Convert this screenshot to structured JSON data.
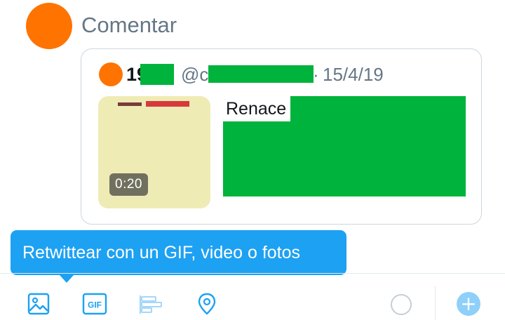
{
  "compose": {
    "placeholder": "Comentar"
  },
  "quoted_tweet": {
    "name_visible": "19",
    "handle_visible": "@c",
    "separator": "·",
    "date": "15/4/19",
    "text_visible": "Renace",
    "media": {
      "duration": "0:20"
    }
  },
  "tooltip": {
    "text": "Retwittear con un GIF, video o fotos"
  },
  "toolbar": {
    "gif_label": "GIF",
    "add_symbol": "+"
  },
  "colors": {
    "avatar": "#ff7300",
    "redaction": "#00b33c",
    "accent": "#1da1f2",
    "muted_text": "#657786",
    "border": "#ccd6dd",
    "thumbnail_bg": "#efebb5"
  },
  "icons": {
    "photo": "image-icon",
    "gif": "gif-icon",
    "poll": "poll-icon",
    "location": "location-pin-icon",
    "char_counter": "progress-ring-icon",
    "add": "add-tweet-icon"
  }
}
